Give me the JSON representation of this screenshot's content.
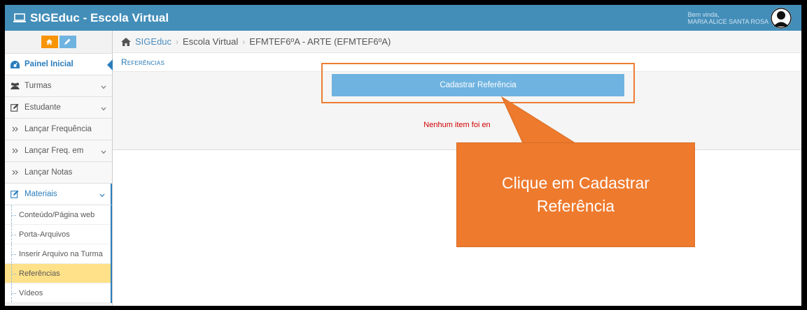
{
  "app": {
    "title": "SIGEduc - Escola Virtual",
    "greeting": "Bem vinda,",
    "user_name": "MARIA ALICE SANTA ROSA"
  },
  "breadcrumb": {
    "items": [
      "SIGEduc",
      "Escola Virtual",
      "EFMTEF6ºA - ARTE (EFMTEF6ºA)"
    ]
  },
  "sidebar": {
    "items": [
      {
        "label": "Painel Inicial",
        "icon": "dashboard-icon"
      },
      {
        "label": "Turmas",
        "icon": "users-icon"
      },
      {
        "label": "Estudante",
        "icon": "edit-icon"
      },
      {
        "label": "Lançar Frequência",
        "icon": "double-chevron-icon"
      },
      {
        "label": "Lançar Freq. em",
        "icon": "double-chevron-icon"
      },
      {
        "label": "Lançar Notas",
        "icon": "double-chevron-icon"
      },
      {
        "label": "Materiais",
        "icon": "edit-icon"
      }
    ],
    "subitems": [
      {
        "label": "Conteúdo/Página web"
      },
      {
        "label": "Porta-Arquivos"
      },
      {
        "label": "Inserir Arquivo na Turma"
      },
      {
        "label": "Referências"
      },
      {
        "label": "Vídeos"
      }
    ]
  },
  "page": {
    "title": "Referências",
    "add_button": "Cadastrar Referência",
    "empty_message": "Nenhum item foi en"
  },
  "callout": {
    "text": "Clique em Cadastrar Referência"
  },
  "colors": {
    "topbar": "#438eb9",
    "accent": "#2b7dbc",
    "button": "#6fb3e0",
    "callout": "#ee7a2e",
    "highlight": "#fee188",
    "error": "#d00000"
  }
}
